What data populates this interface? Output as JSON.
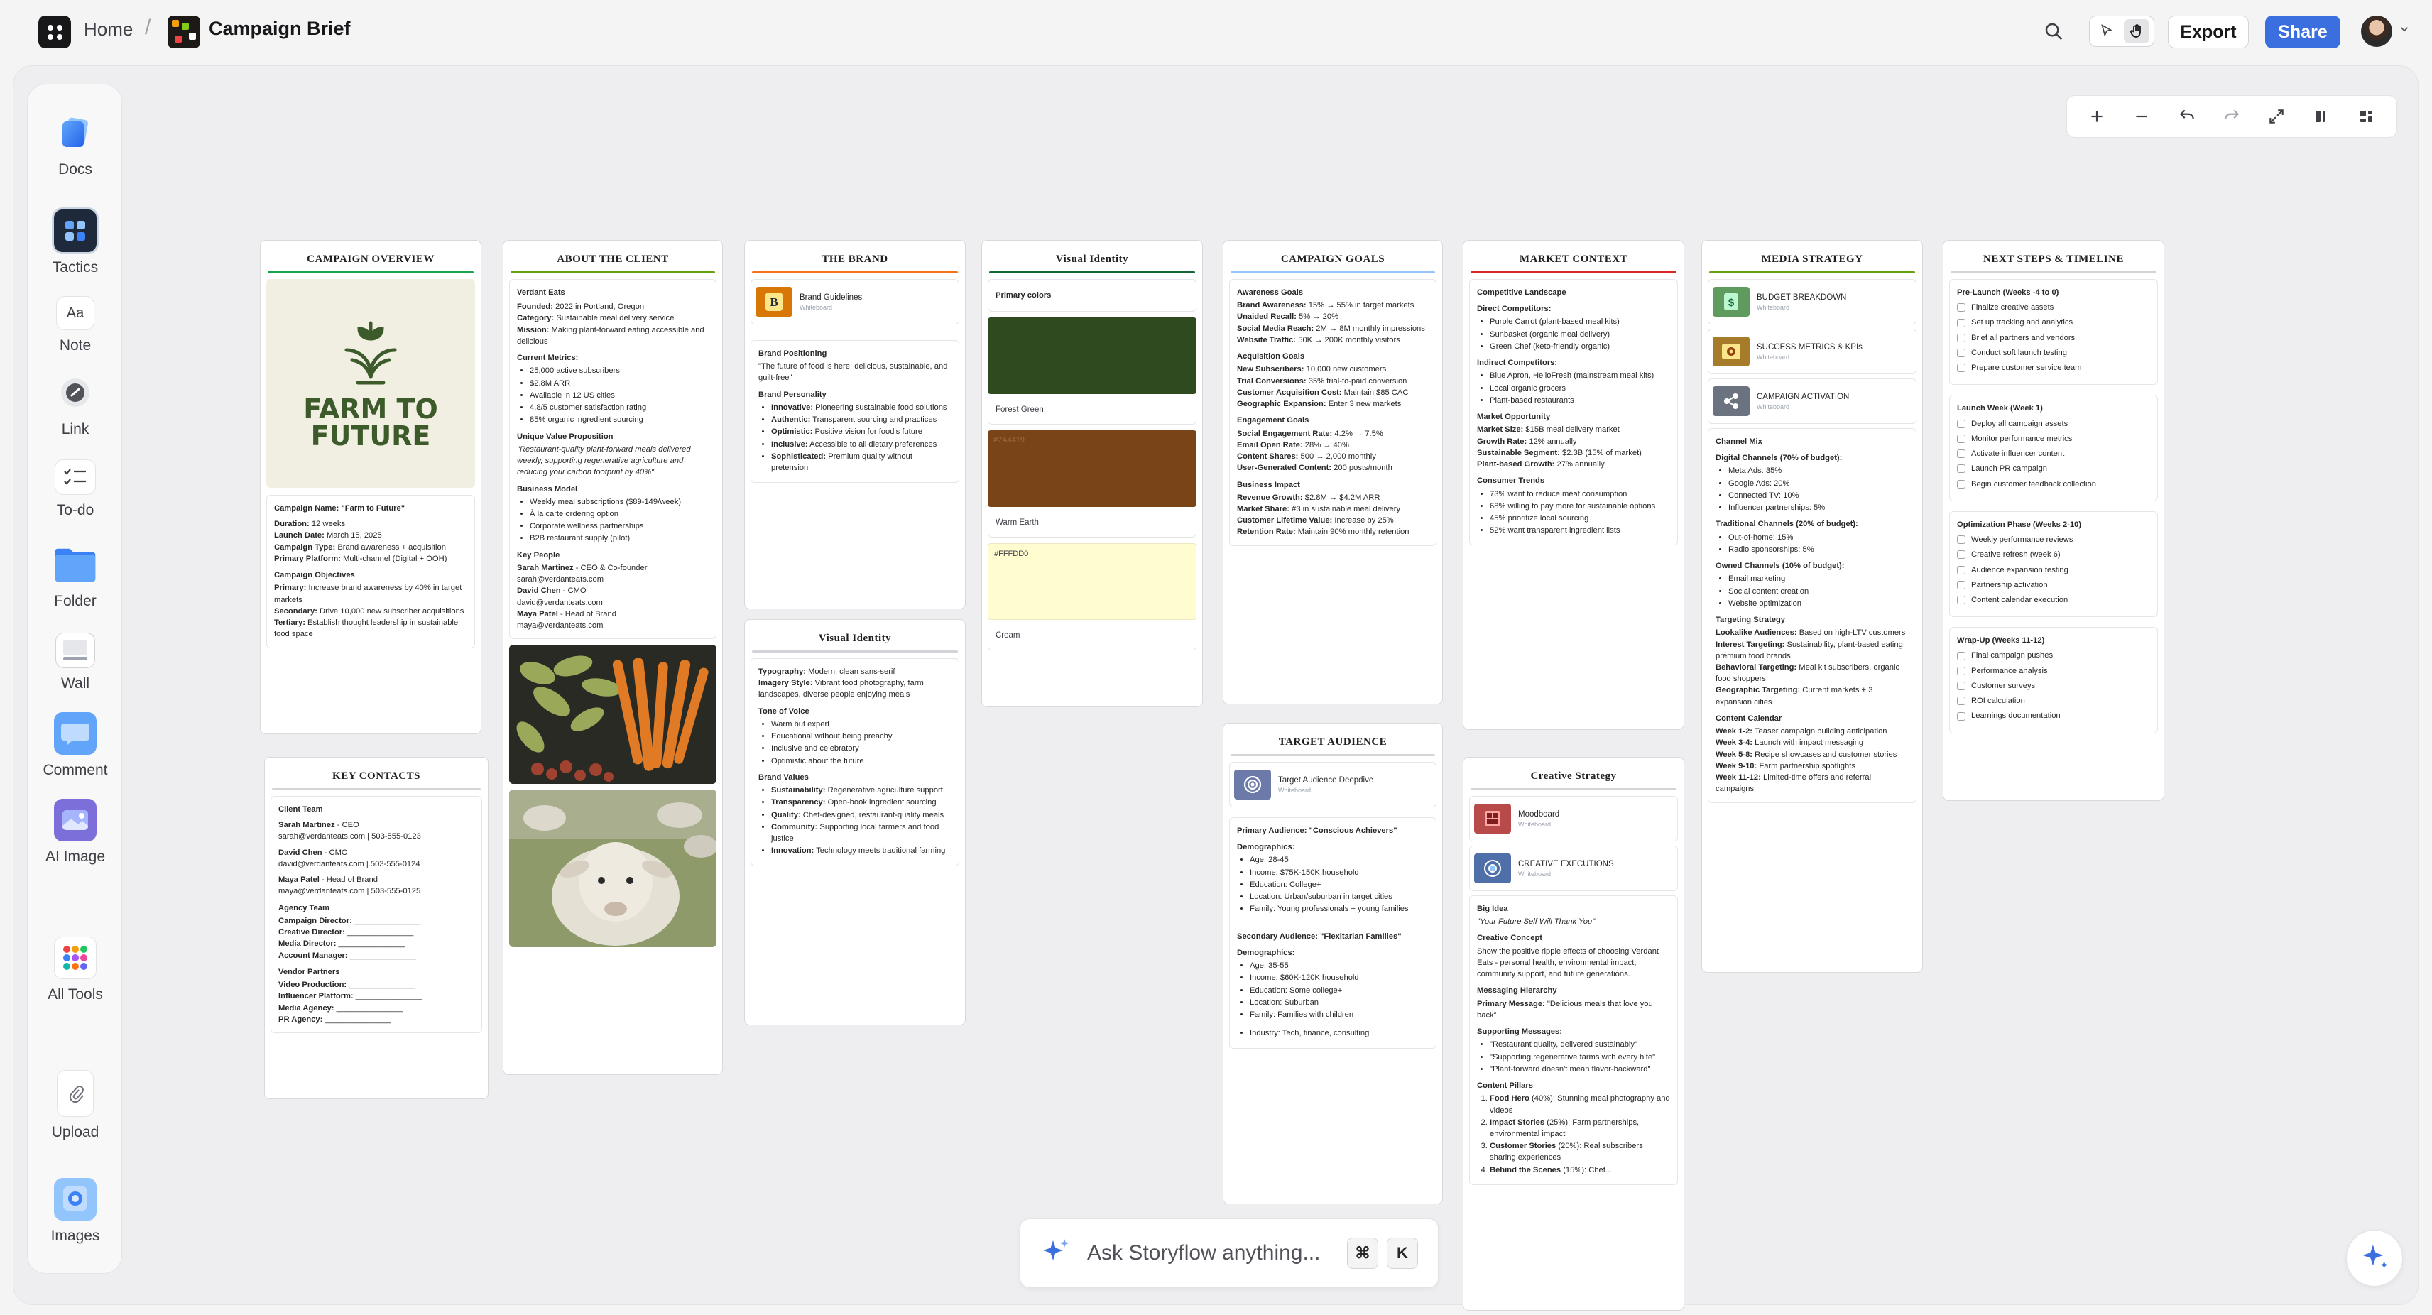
{
  "topbar": {
    "home_label": "Home",
    "separator": "/",
    "doc_title": "Campaign Brief",
    "export_label": "Export",
    "share_label": "Share"
  },
  "colors": {
    "accent": "#3b6fe0",
    "forest_green": "#2f4a1f",
    "brown": "#7a4419",
    "cream": "#FFFDD0"
  },
  "toolbar": {
    "items": [
      {
        "label": "Docs",
        "icon": "docs-icon"
      },
      {
        "label": "Tactics",
        "icon": "tactics-icon"
      },
      {
        "label": "Note",
        "icon": "note-icon",
        "glyph": "Aa"
      },
      {
        "label": "Link",
        "icon": "link-icon"
      },
      {
        "label": "To-do",
        "icon": "todo-icon"
      },
      {
        "label": "Folder",
        "icon": "folder-icon"
      },
      {
        "label": "Wall",
        "icon": "wall-icon"
      },
      {
        "label": "Comment",
        "icon": "comment-icon"
      },
      {
        "label": "AI Image",
        "icon": "ai-image-icon"
      },
      {
        "label": "All Tools",
        "icon": "all-tools-icon"
      },
      {
        "label": "Upload",
        "icon": "upload-icon"
      },
      {
        "label": "Images",
        "icon": "images-icon"
      }
    ]
  },
  "overview": {
    "title": "CAMPAIGN OVERVIEW",
    "logo_line1": "FARM TO",
    "logo_line2": "FUTURE",
    "campaign_name_k": "Campaign Name:",
    "campaign_name_v": "\"Farm to Future\"",
    "duration_k": "Duration:",
    "duration_v": "12 weeks",
    "launch_k": "Launch Date:",
    "launch_v": "March 15, 2025",
    "type_k": "Campaign Type:",
    "type_v": "Brand awareness + acquisition",
    "platform_k": "Primary Platform:",
    "platform_v": "Multi-channel (Digital + OOH)",
    "objectives_h": "Campaign Objectives",
    "primary_k": "Primary:",
    "primary_v": "Increase brand awareness by 40% in target markets",
    "secondary_k": "Secondary:",
    "secondary_v": "Drive 10,000 new subscriber acquisitions",
    "tertiary_k": "Tertiary:",
    "tertiary_v": "Establish thought leadership in sustainable food space"
  },
  "contacts": {
    "title": "KEY CONTACTS",
    "client_h": "Client Team",
    "c1_name": "Sarah Martinez",
    "c1_role": " - CEO",
    "c1_line": "sarah@verdanteats.com | 503-555-0123",
    "c2_name": "David Chen",
    "c2_role": " - CMO",
    "c2_line": "david@verdanteats.com | 503-555-0124",
    "c3_name": "Maya Patel",
    "c3_role": " - Head of Brand",
    "c3_line": "maya@verdanteats.com | 503-555-0125",
    "agency_h": "Agency Team",
    "a1": "Campaign Director:",
    "a2": "Creative Director:",
    "a3": "Media Director:",
    "a4": "Account Manager:",
    "vendor_h": "Vendor Partners",
    "v1": "Video Production:",
    "v2": "Influencer Platform:",
    "v3": "Media Agency:",
    "v4": "PR Agency:",
    "blank": "_______________"
  },
  "client": {
    "title": "ABOUT THE CLIENT",
    "name": "Verdant Eats",
    "founded_k": "Founded:",
    "founded_v": "2022 in Portland, Oregon",
    "category_k": "Category:",
    "category_v": "Sustainable meal delivery service",
    "mission_k": "Mission:",
    "mission_v": "Making plant-forward eating accessible and delicious",
    "metrics_h": "Current Metrics:",
    "metrics": [
      "25,000 active subscribers",
      "$2.8M ARR",
      "Available in 12 US cities",
      "4.8/5 customer satisfaction rating",
      "85% organic ingredient sourcing"
    ],
    "uvp_h": "Unique Value Proposition",
    "uvp": "\"Restaurant-quality plant-forward meals delivered weekly, supporting regenerative agriculture and reducing your carbon footprint by 40%\"",
    "model_h": "Business Model",
    "model": [
      "Weekly meal subscriptions ($89-149/week)",
      "À la carte ordering option",
      "Corporate wellness partnerships",
      "B2B restaurant supply (pilot)"
    ],
    "people_h": "Key People",
    "p1_name": "Sarah Martinez",
    "p1_rest": " - CEO & Co-founder",
    "p1_mail": "sarah@verdanteats.com",
    "p2_name": "David Chen",
    "p2_rest": " - CMO",
    "p2_mail": "david@verdanteats.com",
    "p3_name": "Maya Patel",
    "p3_rest": " - Head of Brand",
    "p3_mail": "maya@verdanteats.com"
  },
  "brand": {
    "title": "THE BRAND",
    "guidelines_title": "Brand Guidelines",
    "guidelines_sub": "Whiteboard",
    "positioning_h": "Brand Positioning",
    "positioning": "\"The future of food is here: delicious, sustainable, and guilt-free\"",
    "personality_h": "Brand Personality",
    "traits": [
      {
        "k": "Innovative:",
        "v": "Pioneering sustainable food solutions"
      },
      {
        "k": "Authentic:",
        "v": "Transparent sourcing and practices"
      },
      {
        "k": "Optimistic:",
        "v": "Positive vision for food's future"
      },
      {
        "k": "Inclusive:",
        "v": "Accessible to all dietary preferences"
      },
      {
        "k": "Sophisticated:",
        "v": "Premium quality without pretension"
      }
    ]
  },
  "identity2": {
    "title": "Visual Identity",
    "typo_k": "Typography:",
    "typo_v": "Modern, clean sans-serif",
    "imagery_k": "Imagery Style:",
    "imagery_v": "Vibrant food photography, farm landscapes, diverse people enjoying meals",
    "tone_h": "Tone of Voice",
    "tone": [
      "Warm but expert",
      "Educational without being preachy",
      "Inclusive and celebratory",
      "Optimistic about the future"
    ],
    "values_h": "Brand Values",
    "values": [
      {
        "k": "Sustainability:",
        "v": "Regenerative agriculture support"
      },
      {
        "k": "Transparency:",
        "v": "Open-book ingredient sourcing"
      },
      {
        "k": "Quality:",
        "v": "Chef-designed, restaurant-quality meals"
      },
      {
        "k": "Community:",
        "v": "Supporting local farmers and food justice"
      },
      {
        "k": "Innovation:",
        "v": "Technology meets traditional farming"
      }
    ]
  },
  "identity": {
    "title": "Visual Identity",
    "primary_h": "Primary colors",
    "green_name": "Forest Green",
    "brown_hex": "#7A4419",
    "brown_name": "Warm Earth",
    "cream_hex": "#FFFDD0",
    "cream_name": "Cream"
  },
  "goals": {
    "title": "CAMPAIGN GOALS",
    "awareness_h": "Awareness Goals",
    "awareness": [
      {
        "k": "Brand Awareness:",
        "v": "15% → 55% in target markets"
      },
      {
        "k": "Unaided Recall:",
        "v": "5% → 20%"
      },
      {
        "k": "Social Media Reach:",
        "v": "2M → 8M monthly impressions"
      },
      {
        "k": "Website Traffic:",
        "v": "50K → 200K monthly visitors"
      }
    ],
    "acq_h": "Acquisition Goals",
    "acq": [
      {
        "k": "New Subscribers:",
        "v": "10,000 new customers"
      },
      {
        "k": "Trial Conversions:",
        "v": "35% trial-to-paid conversion"
      },
      {
        "k": "Customer Acquisition Cost:",
        "v": "Maintain $85 CAC"
      },
      {
        "k": "Geographic Expansion:",
        "v": "Enter 3 new markets"
      }
    ],
    "eng_h": "Engagement Goals",
    "eng": [
      {
        "k": "Social Engagement Rate:",
        "v": "4.2% → 7.5%"
      },
      {
        "k": "Email Open Rate:",
        "v": "28% → 40%"
      },
      {
        "k": "Content Shares:",
        "v": "500 → 2,000 monthly"
      },
      {
        "k": "User-Generated Content:",
        "v": "200 posts/month"
      }
    ],
    "biz_h": "Business Impact",
    "biz": [
      {
        "k": "Revenue Growth:",
        "v": "$2.8M → $4.2M ARR"
      },
      {
        "k": "Market Share:",
        "v": "#3 in sustainable meal delivery"
      },
      {
        "k": "Customer Lifetime Value:",
        "v": "Increase by 25%"
      },
      {
        "k": "Retention Rate:",
        "v": "Maintain 90% monthly retention"
      }
    ]
  },
  "audience": {
    "title": "TARGET AUDIENCE",
    "link_title": "Target Audience Deepdive",
    "link_sub": "Whiteboard",
    "primary_h": "Primary Audience: \"Conscious Achievers\"",
    "demo_h": "Demographics:",
    "primary_demo": [
      "Age: 28-45",
      "Income: $75K-150K household",
      "Education: College+",
      "Location: Urban/suburban in target cities",
      "Family: Young professionals + young families"
    ],
    "secondary_h": "Secondary Audience: \"Flexitarian Families\"",
    "secondary_demo": [
      "Age: 35-55",
      "Income: $60K-120K household",
      "Education: Some college+",
      "Location: Suburban",
      "Family: Families with children",
      "Industry: Tech, finance, consulting"
    ]
  },
  "market": {
    "title": "MARKET CONTEXT",
    "landscape_h": "Competitive Landscape",
    "direct_h": "Direct Competitors:",
    "direct": [
      "Purple Carrot (plant-based meal kits)",
      "Sunbasket (organic meal delivery)",
      "Green Chef (keto-friendly organic)"
    ],
    "indirect_h": "Indirect Competitors:",
    "indirect": [
      "Blue Apron, HelloFresh (mainstream meal kits)",
      "Local organic grocers",
      "Plant-based restaurants"
    ],
    "opp_h": "Market Opportunity",
    "opp": [
      {
        "k": "Market Size:",
        "v": "$15B meal delivery market"
      },
      {
        "k": "Growth Rate:",
        "v": "12% annually"
      },
      {
        "k": "Sustainable Segment:",
        "v": "$2.3B (15% of market)"
      },
      {
        "k": "Plant-based Growth:",
        "v": "27% annually"
      }
    ],
    "trends_h": "Consumer Trends",
    "trends": [
      "73% want to reduce meat consumption",
      "68% willing to pay more for sustainable options",
      "45% prioritize local sourcing",
      "52% want transparent ingredient lists"
    ]
  },
  "creative": {
    "title": "Creative Strategy",
    "moodboard_title": "Moodboard",
    "moodboard_sub": "Whiteboard",
    "exec_title": "CREATIVE EXECUTIONS",
    "exec_sub": "Whiteboard",
    "idea_h": "Big Idea",
    "idea": "\"Your Future Self Will Thank You\"",
    "concept_h": "Creative Concept",
    "concept": "Show the positive ripple effects of choosing Verdant Eats - personal health, environmental impact, community support, and future generations.",
    "hier_h": "Messaging Hierarchy",
    "primary_k": "Primary Message:",
    "primary_v": "\"Delicious meals that love you back\"",
    "supporting_h": "Supporting Messages:",
    "supporting": [
      "\"Restaurant quality, delivered sustainably\"",
      "\"Supporting regenerative farms with every bite\"",
      "\"Plant-forward doesn't mean flavor-backward\""
    ],
    "pillars_h": "Content Pillars",
    "pillars": [
      {
        "k": "Food Hero",
        "v": " (40%): Stunning meal photography and videos"
      },
      {
        "k": "Impact Stories",
        "v": " (25%): Farm partnerships, environmental impact"
      },
      {
        "k": "Customer Stories",
        "v": " (20%): Real subscribers sharing experiences"
      },
      {
        "k": "Behind the Scenes",
        "v": " (15%): Chef..."
      }
    ]
  },
  "media": {
    "title": "MEDIA STRATEGY",
    "l1_title": "BUDGET BREAKDOWN",
    "l1_sub": "Whiteboard",
    "l2_title": "SUCCESS METRICS & KPIs",
    "l2_sub": "Whiteboard",
    "l3_title": "CAMPAIGN ACTIVATION",
    "l3_sub": "Whiteboard",
    "mix_h": "Channel Mix",
    "digital_h": "Digital Channels (70% of budget):",
    "digital": [
      "Meta Ads: 35%",
      "Google Ads: 20%",
      "Connected TV: 10%",
      "Influencer partnerships: 5%"
    ],
    "trad_h": "Traditional Channels (20% of budget):",
    "trad": [
      "Out-of-home: 15%",
      "Radio sponsorships: 5%"
    ],
    "owned_h": "Owned Channels (10% of budget):",
    "owned": [
      "Email marketing",
      "Social content creation",
      "Website optimization"
    ],
    "target_h": "Targeting Strategy",
    "targeting": [
      {
        "k": "Lookalike Audiences:",
        "v": "Based on high-LTV customers"
      },
      {
        "k": "Interest Targeting:",
        "v": "Sustainability, plant-based eating, premium food brands"
      },
      {
        "k": "Behavioral Targeting:",
        "v": "Meal kit subscribers, organic food shoppers"
      },
      {
        "k": "Geographic Targeting:",
        "v": "Current markets + 3 expansion cities"
      }
    ],
    "cal_h": "Content Calendar",
    "calendar": [
      {
        "k": "Week 1-2:",
        "v": "Teaser campaign building anticipation"
      },
      {
        "k": "Week 3-4:",
        "v": "Launch with impact messaging"
      },
      {
        "k": "Week 5-8:",
        "v": "Recipe showcases and customer stories"
      },
      {
        "k": "Week 9-10:",
        "v": "Farm partnership spotlights"
      },
      {
        "k": "Week 11-12:",
        "v": "Limited-time offers and referral campaigns"
      }
    ]
  },
  "next": {
    "title": "NEXT STEPS & TIMELINE",
    "phases": [
      {
        "h": "Pre-Launch (Weeks -4 to 0)",
        "items": [
          "Finalize creative assets",
          "Set up tracking and analytics",
          "Brief all partners and vendors",
          "Conduct soft launch testing",
          "Prepare customer service team"
        ]
      },
      {
        "h": "Launch Week (Week 1)",
        "items": [
          "Deploy all campaign assets",
          "Monitor performance metrics",
          "Activate influencer content",
          "Launch PR campaign",
          "Begin customer feedback collection"
        ]
      },
      {
        "h": "Optimization Phase (Weeks 2-10)",
        "items": [
          "Weekly performance reviews",
          "Creative refresh (week 6)",
          "Audience expansion testing",
          "Partnership activation",
          "Content calendar execution"
        ]
      },
      {
        "h": "Wrap-Up (Weeks 11-12)",
        "items": [
          "Final campaign pushes",
          "Performance analysis",
          "Customer surveys",
          "ROI calculation",
          "Learnings documentation"
        ]
      }
    ]
  },
  "ask": {
    "placeholder": "Ask Storyflow anything...",
    "key1": "⌘",
    "key2": "K"
  }
}
